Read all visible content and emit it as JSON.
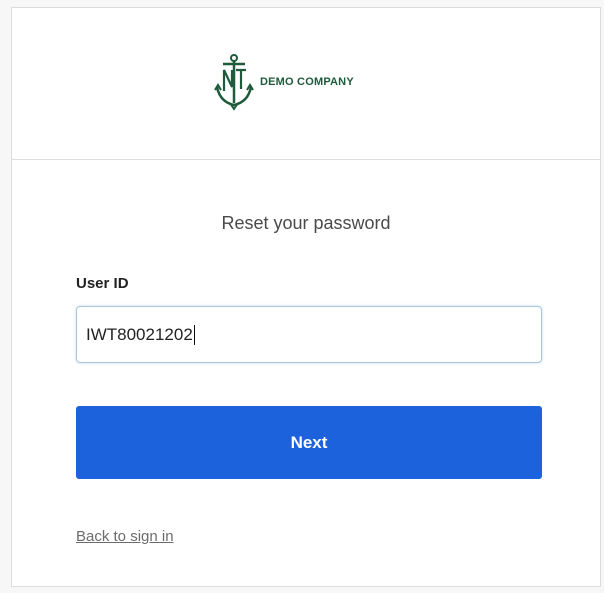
{
  "header": {
    "brand_name": "DEMO COMPANY",
    "logo_icon": "anchor-nt-monogram-icon",
    "brand_color": "#1f5a3c"
  },
  "form": {
    "title": "Reset your password",
    "user_id_label": "User ID",
    "user_id_value": "IWT80021202",
    "next_label": "Next",
    "back_link": "Back to sign in",
    "button_color": "#1b62dc"
  }
}
